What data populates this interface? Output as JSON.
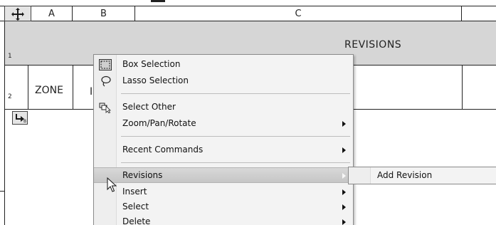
{
  "table": {
    "columns": [
      {
        "key": "A",
        "label": "A"
      },
      {
        "key": "B",
        "label": "B"
      },
      {
        "key": "C",
        "label": "C"
      }
    ],
    "rows": [
      {
        "number": "1",
        "text": "REVISIONS"
      },
      {
        "number": "2",
        "zone_label": "ZONE",
        "col_b_fragment": "I"
      }
    ]
  },
  "context_menu": {
    "items": [
      {
        "label": "Box Selection",
        "icon": "box-selection-icon",
        "has_submenu": false
      },
      {
        "label": "Lasso Selection",
        "icon": "lasso-selection-icon",
        "has_submenu": false
      },
      {
        "label": "Select Other",
        "icon": "select-other-icon",
        "has_submenu": false
      },
      {
        "label": "Zoom/Pan/Rotate",
        "icon": "",
        "has_submenu": true
      },
      {
        "label": "Recent Commands",
        "icon": "",
        "has_submenu": true
      },
      {
        "label": "Revisions",
        "icon": "",
        "has_submenu": true,
        "highlighted": true
      },
      {
        "label": "Insert",
        "icon": "",
        "has_submenu": true
      },
      {
        "label": "Select",
        "icon": "",
        "has_submenu": true
      },
      {
        "label": "Delete",
        "icon": "",
        "has_submenu": true
      }
    ]
  },
  "submenu": {
    "items": [
      {
        "label": "Add Revision"
      }
    ]
  },
  "colors": {
    "header_band": "#d6d6d6",
    "menu_background": "#f3f3f3",
    "menu_highlight": "#cfcfcf"
  }
}
